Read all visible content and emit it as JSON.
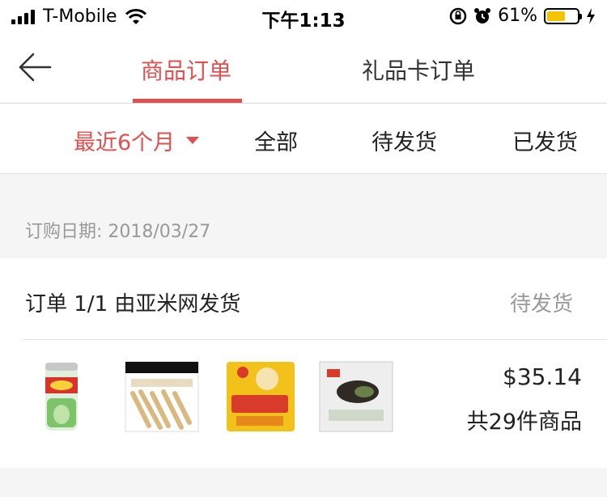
{
  "status_bar": {
    "carrier": "T-Mobile",
    "time": "下午1:13",
    "battery": "61%",
    "battery_level": 0.61
  },
  "header": {
    "tabs": [
      "商品订单",
      "礼品卡订单"
    ],
    "active_tab": "商品订单"
  },
  "filter": {
    "recent": "最近6个月",
    "all": "全部",
    "pending": "待发货",
    "shipped": "已发货"
  },
  "order": {
    "date": "订购日期: 2018/03/27",
    "title": "订单 1/1 由亚米网发货",
    "status": "待发货",
    "price": "$35.14",
    "count": "共29件商品"
  },
  "colors": {
    "accent": "#e24f4f",
    "muted": "#999999",
    "background": "#f5f5f5"
  }
}
